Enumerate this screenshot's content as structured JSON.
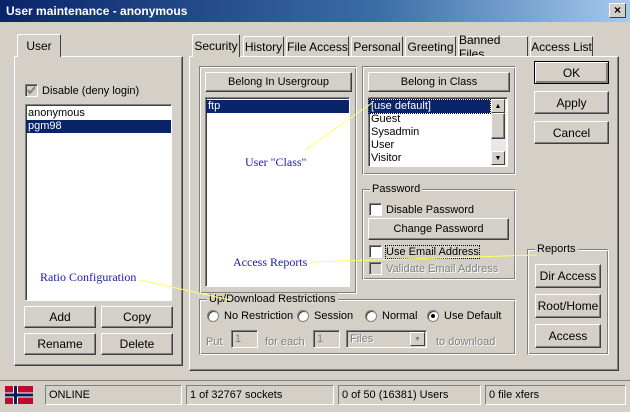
{
  "window": {
    "title": "User maintenance - anonymous",
    "close_label": "×"
  },
  "left": {
    "tab_label": "User",
    "disable_label": "Disable (deny login)",
    "users": [
      "anonymous",
      "pgm98"
    ],
    "buttons": {
      "add": "Add",
      "copy": "Copy",
      "rename": "Rename",
      "delete": "Delete"
    }
  },
  "tabs": [
    "Security",
    "History",
    "File Access",
    "Personal",
    "Greeting",
    "Banned Files",
    "Access List"
  ],
  "usergroup": {
    "header": "Belong In Usergroup",
    "items": [
      "ftp"
    ]
  },
  "class": {
    "header": "Belong in Class",
    "items": [
      "[use default]",
      "Guest",
      "Sysadmin",
      "User",
      "Visitor"
    ]
  },
  "password": {
    "legend": "Password",
    "disable_password": "Disable Password",
    "change_password": "Change Password",
    "use_email": "Use Email Address",
    "validate_email": "Validate Email Address"
  },
  "updown": {
    "legend": "Up/Download Restrictions",
    "options": [
      "No Restriction",
      "Session",
      "Normal",
      "Use Default"
    ],
    "put_label": "Put",
    "put_value": "1",
    "for_each_label": "for each",
    "for_each_value": "1",
    "unit_value": "Files",
    "to_download_label": "to download"
  },
  "actions": {
    "ok": "OK",
    "apply": "Apply",
    "cancel": "Cancel"
  },
  "reports": {
    "legend": "Reports",
    "dir_access": "Dir Access",
    "root_home": "Root/Home",
    "access": "Access"
  },
  "annotations": {
    "user_class": "User \"Class\"",
    "access_reports": "Access Reports",
    "ratio_configuration": "Ratio Configuration"
  },
  "status": {
    "online": "ONLINE",
    "sockets": "1 of 32767 sockets",
    "users": "0 of 50 (16381) Users",
    "xfers": "0 file xfers"
  },
  "colors": {
    "title_active": "#0a246a",
    "selection": "#0a246a",
    "annotation": "#1a1aaa",
    "annotation_line": "#ffff66"
  }
}
